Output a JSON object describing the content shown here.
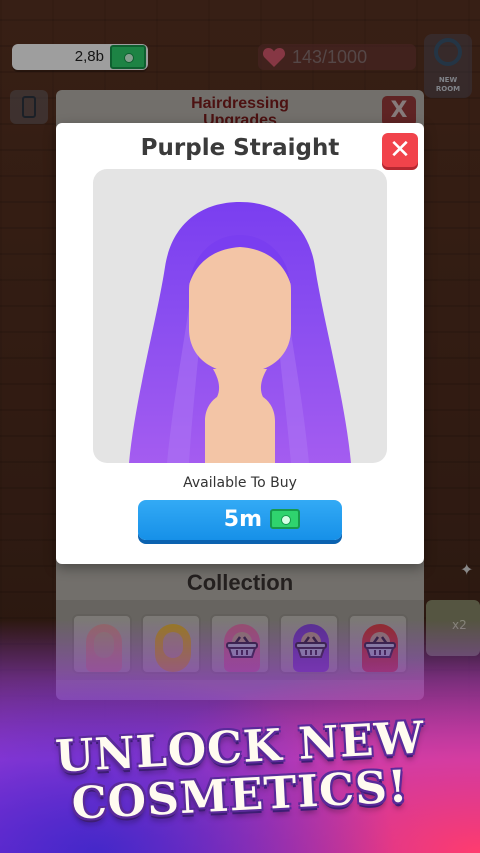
{
  "hud": {
    "money": "2,8b",
    "hearts": "143/1000",
    "new_room_label": "NEW\nROOM"
  },
  "upgrades_panel": {
    "title": "Hairdressing\nUpgrades",
    "close_label": "X",
    "collection_title": "Collection",
    "collection_items": [
      {
        "name": "pink-straight",
        "state": "owned",
        "color": "#e8a7a3"
      },
      {
        "name": "blonde-curly",
        "state": "owned",
        "color": "#f2c437"
      },
      {
        "name": "pink-pigtails",
        "state": "locked",
        "color": "#f07fb0"
      },
      {
        "name": "purple-straight",
        "state": "locked",
        "color": "#8d4de8"
      },
      {
        "name": "red-wavy",
        "state": "locked",
        "color": "#e84646"
      }
    ],
    "side_multiplier": "x2"
  },
  "modal": {
    "title": "Purple Straight",
    "close_label": "✕",
    "status": "Available To Buy",
    "price": "5m",
    "hair_color": "#8a4ef0",
    "skin_color": "#f3c5a6"
  },
  "banner": {
    "line1": "UNLOCK NEW",
    "line2": "COSMETICS!"
  }
}
